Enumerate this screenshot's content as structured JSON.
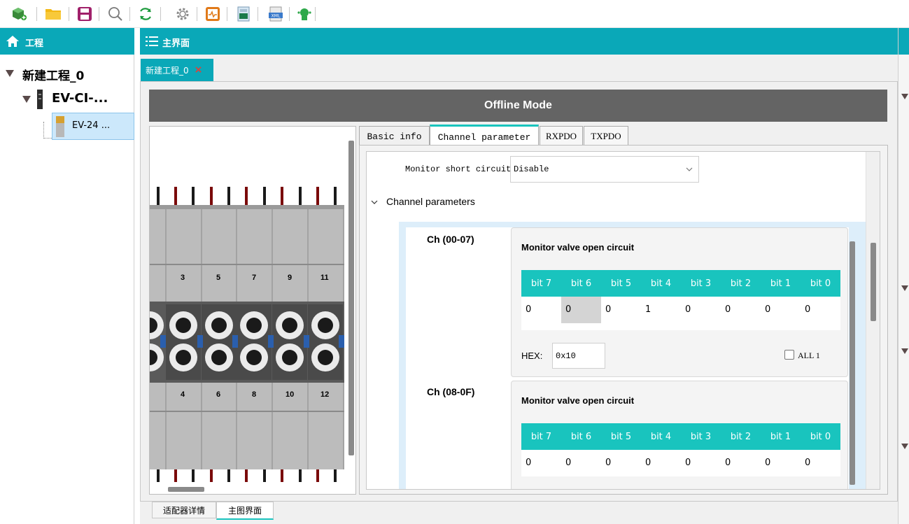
{
  "colors": {
    "accent": "#0aa8b8",
    "bit_header": "#19c4be",
    "offline_bar": "#646464",
    "close_x": "#e0403a"
  },
  "toolbar": {
    "icons": [
      "new-project-icon",
      "open-folder-icon",
      "save-icon",
      "search-icon",
      "refresh-icon",
      "settings-icon",
      "monitor-icon",
      "export-icon",
      "xml-icon",
      "device-scan-icon"
    ]
  },
  "left": {
    "title": "工程"
  },
  "tree": {
    "root": "新建工程_0",
    "adapter": "EV-CI-...",
    "module": "EV-24 ..."
  },
  "main": {
    "title": "主界面",
    "doc_tab": "新建工程_0",
    "close": "×"
  },
  "offline": "Offline Mode",
  "module_numbers": {
    "top": [
      "3",
      "5",
      "7",
      "9",
      "11"
    ],
    "bottom": [
      "4",
      "6",
      "8",
      "10",
      "12"
    ]
  },
  "tabs": [
    "Basic info",
    "Channel parameter",
    "RXPDO",
    "TXPDO"
  ],
  "monitor_short": {
    "label": "Monitor short circuit",
    "value": "Disable"
  },
  "section": "Channel parameters",
  "channels": [
    {
      "label": "Ch (00-07)",
      "title": "Monitor valve open circuit",
      "bits": [
        "bit 7",
        "bit 6",
        "bit 5",
        "bit 4",
        "bit 3",
        "bit 2",
        "bit 1",
        "bit 0"
      ],
      "values": [
        "0",
        "0",
        "0",
        "1",
        "0",
        "0",
        "0",
        "0"
      ],
      "hex_label": "HEX:",
      "hex": "0x10",
      "all_label": "ALL 1"
    },
    {
      "label": "Ch (08-0F)",
      "title": "Monitor valve open circuit",
      "bits": [
        "bit 7",
        "bit 6",
        "bit 5",
        "bit 4",
        "bit 3",
        "bit 2",
        "bit 1",
        "bit 0"
      ],
      "values": [
        "0",
        "0",
        "0",
        "0",
        "0",
        "0",
        "0",
        "0"
      ]
    }
  ],
  "bottom_tabs": [
    "适配器详情",
    "主图界面"
  ]
}
